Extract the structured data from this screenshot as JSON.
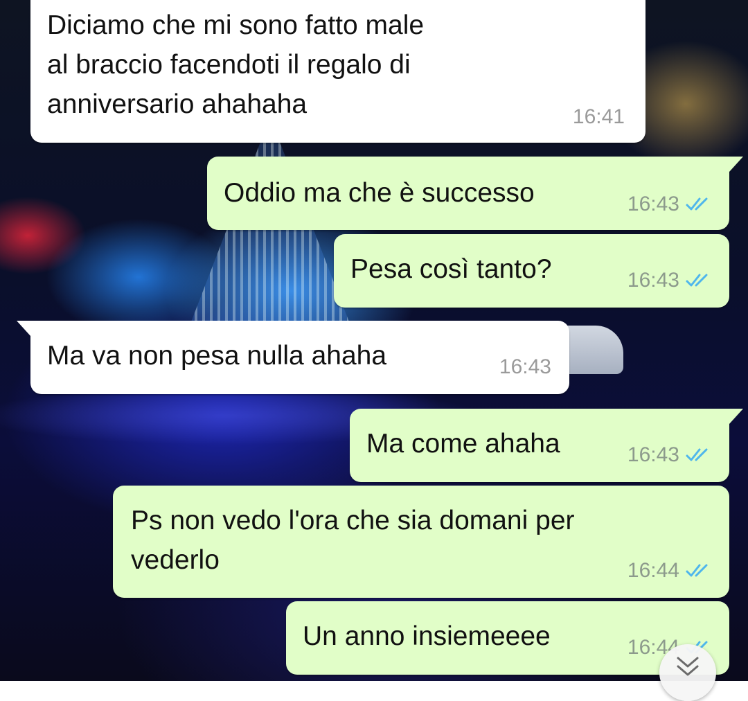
{
  "chat": {
    "messages": [
      {
        "direction": "in",
        "lines": [
          "Diciamo che mi sono fatto male",
          "al braccio facendoti il regalo di",
          "anniversario ahahaha"
        ],
        "time": "16:41"
      },
      {
        "direction": "out",
        "lines": [
          "Oddio ma che è successo"
        ],
        "time": "16:43",
        "status": "read"
      },
      {
        "direction": "out",
        "lines": [
          "Pesa così tanto?"
        ],
        "time": "16:43",
        "status": "read"
      },
      {
        "direction": "in",
        "lines": [
          "Ma va non pesa nulla ahaha"
        ],
        "time": "16:43"
      },
      {
        "direction": "out",
        "lines": [
          "Ma come ahaha"
        ],
        "time": "16:43",
        "status": "read"
      },
      {
        "direction": "out",
        "lines": [
          "Ps non vedo l'ora che sia domani per",
          "vederlo"
        ],
        "time": "16:44",
        "status": "read"
      },
      {
        "direction": "out",
        "lines": [
          "Un anno insiemeeee"
        ],
        "time": "16:44",
        "status": "read"
      }
    ]
  },
  "colors": {
    "incoming_bubble": "#ffffff",
    "outgoing_bubble": "#e1fec8",
    "read_ticks": "#4fb6ec",
    "timestamp": "#8c9a8c"
  },
  "icons": {
    "read_status": "double-check-icon",
    "scroll_down": "double-chevron-down-icon"
  }
}
